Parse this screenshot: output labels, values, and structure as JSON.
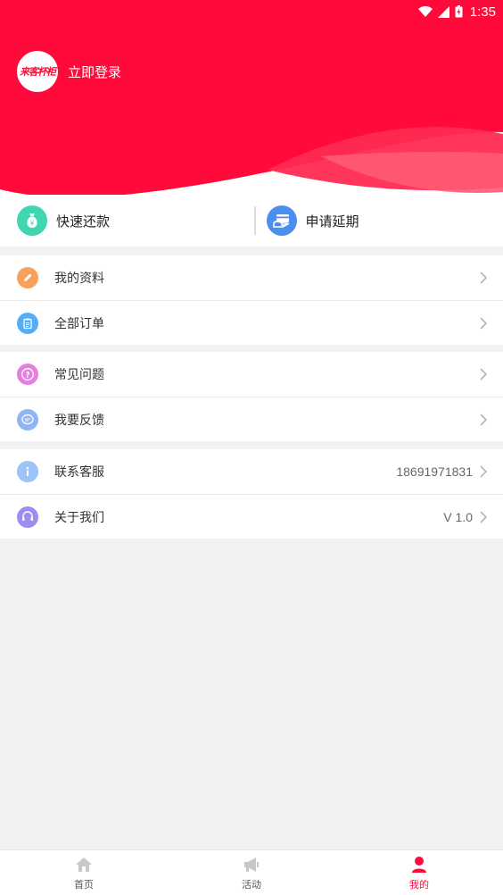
{
  "status_bar": {
    "time": "1:35"
  },
  "header": {
    "logo_text": "来客杯柜",
    "login_label": "立即登录"
  },
  "quick_actions": [
    {
      "label": "快速还款"
    },
    {
      "label": "申请延期"
    }
  ],
  "menu_groups": {
    "g1": [
      {
        "label": "我的资料"
      },
      {
        "label": "全部订单"
      }
    ],
    "g2": [
      {
        "label": "常见问题"
      },
      {
        "label": "我要反馈"
      }
    ],
    "g3": [
      {
        "label": "联系客服",
        "value": "18691971831"
      },
      {
        "label": "关于我们",
        "value": "V 1.0"
      }
    ]
  },
  "tabbar": [
    {
      "label": "首页",
      "icon": "home-icon"
    },
    {
      "label": "活动",
      "icon": "megaphone-icon"
    },
    {
      "label": "我的",
      "icon": "user-icon"
    }
  ],
  "colors": {
    "brand": "#ff0a3a",
    "inactive_icon": "#c8c8c8"
  }
}
